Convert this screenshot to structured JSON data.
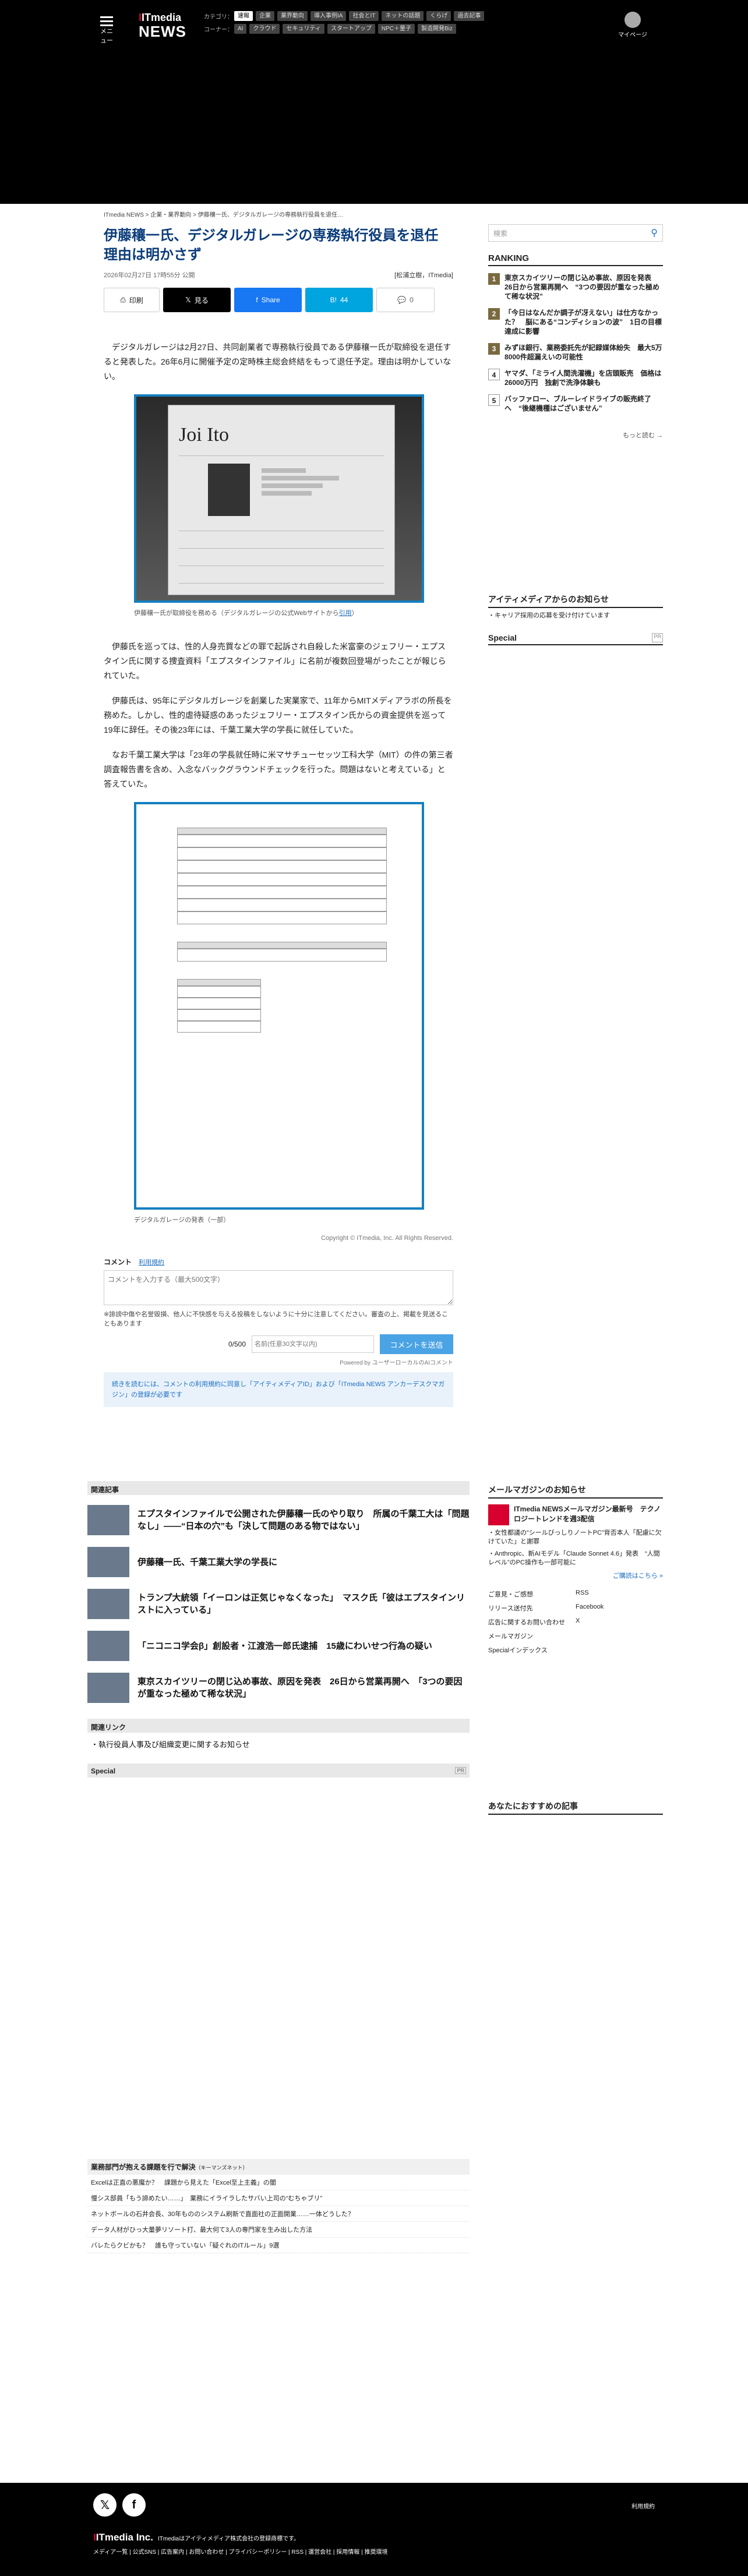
{
  "header": {
    "menu_label": "メニュー",
    "logo_top": "ITmedia",
    "logo_bottom": "NEWS",
    "category_label": "カテゴリ：",
    "categories": [
      "速報",
      "企業",
      "業界動向",
      "導入事例IA",
      "社会とIT",
      "ネットの話題",
      "くらげ",
      "過去記事"
    ],
    "corner_label": "コーナー：",
    "corners": [
      "AI",
      "クラウド",
      "セキュリティ",
      "スタートアップ",
      "NPC＋量子",
      "製造開発Biz"
    ],
    "mypage": "マイページ"
  },
  "article": {
    "breadcrumb": "ITmedia NEWS > 企業・業界動向 > 伊藤穰一氏、デジタルガレージの専務執行役員を退任…",
    "title": "伊藤穰一氏、デジタルガレージの専務執行役員を退任　理由は明かさず",
    "date": "2026年02月27日 17時55分 公開",
    "author": "[松浦立樹，ITmedia]",
    "share": {
      "print": "印刷",
      "x": "見る",
      "fb": "Share",
      "hb": "44",
      "comments": "0"
    },
    "paragraphs": [
      "デジタルガレージは2月27日、共同創業者で専務執行役員である伊藤穰一氏が取締役を退任すると発表した。26年6月に開催予定の定時株主総会終結をもって退任予定。理由は明かしていない。",
      "伊藤氏を巡っては、性的人身売買などの罪で起訴され自殺した米富豪のジェフリー・エプスタイン氏に関する捜査資料「エプスタインファイル」に名前が複数回登場がったことが報じられていた。",
      "伊藤氏は、95年にデジタルガレージを創業した実業家で、11年からMITメディアラボの所長を務めた。しかし、性的虐待疑惑のあったジェフリー・エプスタイン氏からの資金提供を巡って19年に辞任。その後23年には、千葉工業大学の学長に就任していた。",
      "なお千葉工業大学は「23年の学長就任時に米マサチューセッツ工科大学（MIT）の件の第三者調査報告書を含め、入念なバックグラウンドチェックを行った。問題はないと考えている」と答えていた。"
    ],
    "fig1": {
      "name": "Joi Ito",
      "caption": "伊藤穰一氏が取締役を務める（デジタルガレージの公式Webサイトから",
      "caption_link": "引用",
      "caption_end": "）"
    },
    "fig2": {
      "caption": "デジタルガレージの発表（一部）"
    },
    "copyright": "Copyright © ITmedia, Inc. All Rights Reserved."
  },
  "comment": {
    "label": "コメント",
    "terms": "利用規約",
    "placeholder": "コメントを入力する（最大500文字）",
    "note": "※誹謗中傷や名誉毀損、他人に不快感を与える投稿をしないように十分に注意してください。審査の上、掲載を見送ることもあります",
    "count": "0/500",
    "name_placeholder": "名前(任意30文字以内)",
    "submit": "コメントを送信",
    "powered": "Powered by ユーザーローカルのAIコメント",
    "notice": "続きを読むには、コメントの利用規約に同意し「アイティメディアID」および「ITmedia NEWS アンカーデスクマガジン」の登録が必要です"
  },
  "related": {
    "heading": "関連記事",
    "items": [
      "エプスタインファイルで公開された伊藤穰一氏のやり取り　所属の千葉工大は「問題なし」――“日本の穴”も「決して問題のある物ではない」",
      "伊藤穰一氏、千葉工業大学の学長に",
      "トランプ大統領「イーロンは正気じゃなくなった」　マスク氏「彼はエプスタインリストに入っている」",
      "「ニコニコ学会β」創設者・江渡浩一郎氏逮捕　15歳にわいせつ行為の疑い",
      "東京スカイツリーの閉じ込め事故、原因を発表　26日から営業再開へ　「3つの要因が重なった極めて稀な状況」"
    ],
    "links_heading": "関連リンク",
    "links": [
      "執行役員人事及び組織変更に関するお知らせ"
    ],
    "special": "Special",
    "pr": "PR"
  },
  "business": {
    "heading": "業務部門が抱える課題を行で解決",
    "tag": "（キーマンズネット）",
    "items": [
      "Excelは正直の悪魔か？　課題から見えた「Excel至上主義」の闇",
      "慢シス部員「もう諦めたい……」　業務にイライラしたサバい上司の“むちゃブリ”",
      "ネットボールの石井会長、30年もののシステム刷新で直面社の正面開業……一体どうした？",
      "データ人材がひっ大量夢リソート打、最大何て3人の専門家を生み出した方法",
      "バレたらクビかも？　誰も守っていない「疑ぐれのITルール」9選"
    ]
  },
  "sidebar": {
    "search_placeholder": "検索",
    "ranking_title": "RANKING",
    "ranking": [
      "東京スカイツリーの閉じ込め事故、原因を発表　26日から営業再開へ　“3つの要因が重なった極めて稀な状況”",
      "「今日はなんだか調子が冴えない」は仕方なかった？　脳にある“コンディションの波”　1日の目標達成に影響",
      "みずほ銀行、業務委託先が記録媒体紛失　最大5万8000件超漏えいの可能性",
      "ヤマダ、「ミライ人間洗濯機」を店頭販売　価格は26000万円　独創で洗浄体験も",
      "バッファロー、ブルーレイドライブの販売終了へ　“後継機種はございません”"
    ],
    "more": "もっと読む →",
    "notice_title": "アイティメディアからのお知らせ",
    "notice_item": "キャリア採用の応募を受け付けています",
    "special": "Special",
    "pr": "PR",
    "mail_title": "メールマガジンのお知らせ",
    "mail_lead": "ITmedia NEWSメールマガジン最新号　テクノロジートレンドを週3配信",
    "mail_items": [
      "女性都議の“シールびっしりノートPC”背否本人「配慮に欠けていた」と謝罪",
      "Anthropic、新AIモデル「Claude Sonnet 4.6」発表　“人間レベル”のPC操作も一部可能に"
    ],
    "mail_more": "ご購読はこちら »",
    "links": [
      "ご意見・ご感想",
      "RSS",
      "リリース送付先",
      "Facebook",
      "広告に関するお問い合わせ",
      "X",
      "メールマガジン",
      "",
      "Specialインデックス",
      ""
    ],
    "recommend": "あなたにおすすめの記事"
  },
  "footer": {
    "logo": "ITmedia Inc.",
    "tagline": "ITmediaはアイティメディア株式会社の登録商標です。",
    "links": "メディア一覧 | 公式SNS | 広告案内 | お問い合わせ | プライバシーポリシー | RSS | 運営会社 | 採用情報 | 推奨環境",
    "right": "利用規約"
  }
}
